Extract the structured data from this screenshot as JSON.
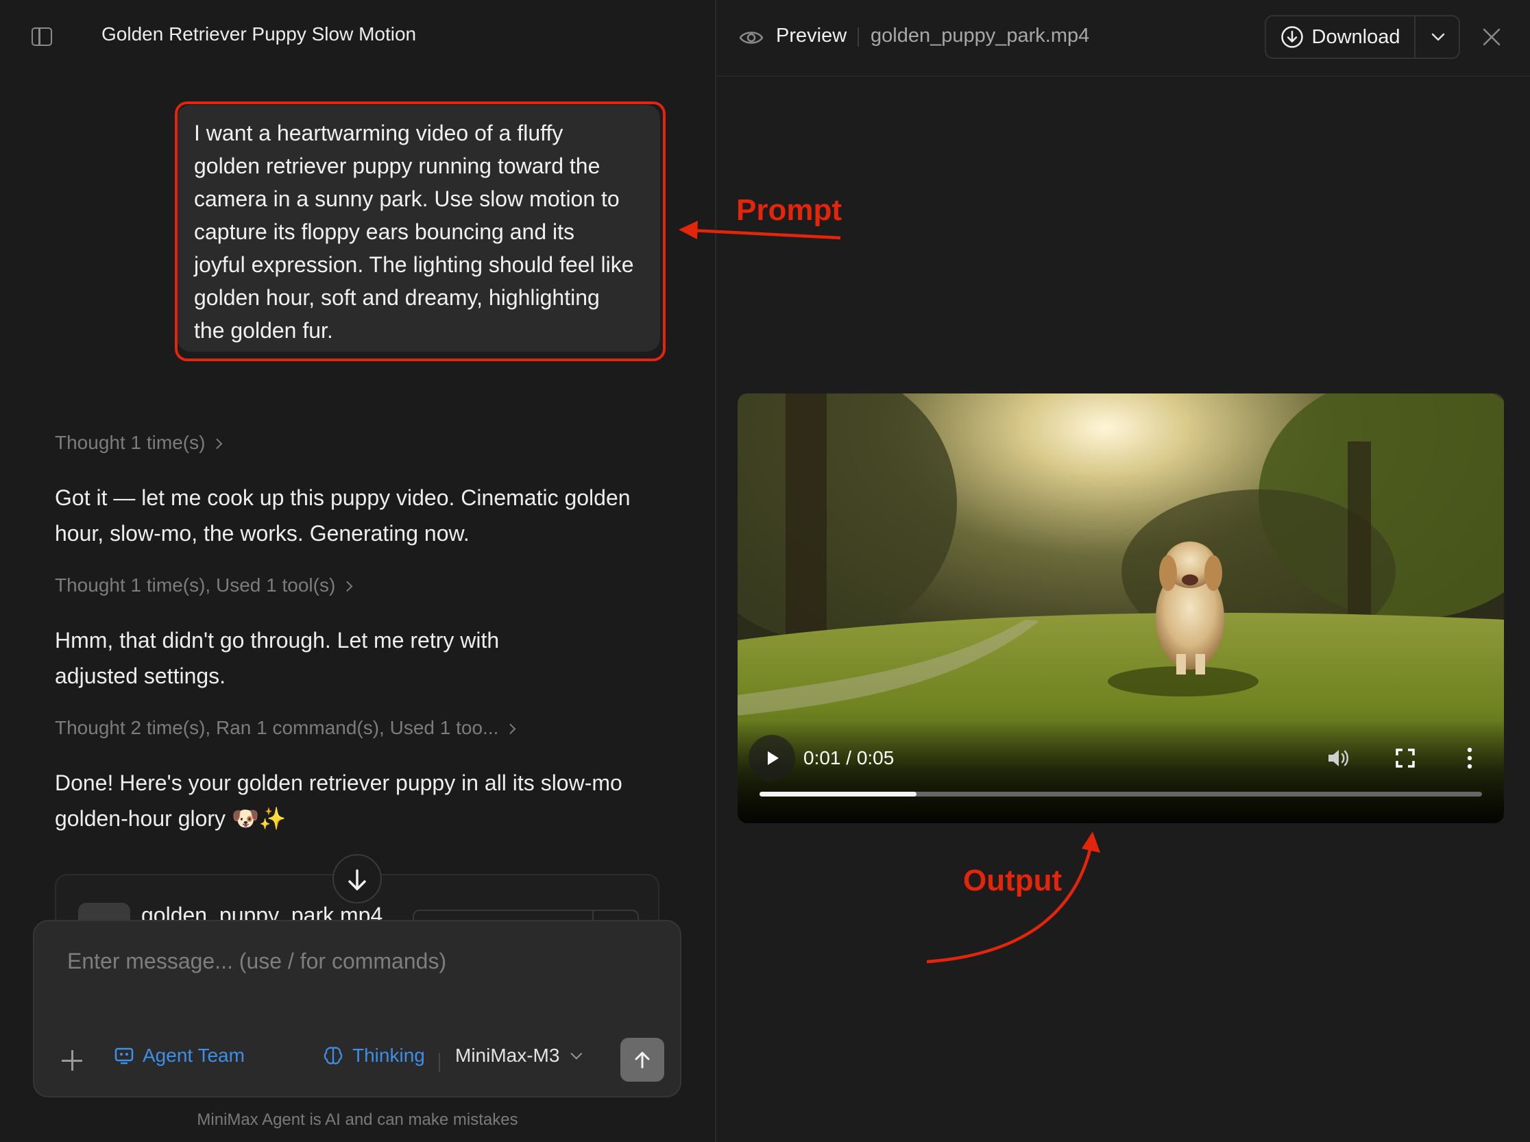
{
  "chat": {
    "title": "Golden Retriever Puppy Slow Motion",
    "prompt_lines": [
      "I want a heartwarming video of a fluffy",
      "golden retriever puppy running toward the",
      "camera in a sunny park. Use slow motion to",
      "capture its floppy ears bouncing and its",
      "joyful expression. The lighting should feel like",
      "golden hour, soft and dreamy, highlighting",
      "the golden fur."
    ],
    "thought_1": "Thought 1 time(s)",
    "msg_1_lines": [
      "Got it — let me cook up this puppy video. Cinematic golden",
      "hour, slow-mo, the works. Generating now."
    ],
    "thought_2": "Thought 1 time(s), Used 1 tool(s)",
    "msg_2_lines": [
      "Hmm, that didn't go through. Let me retry with",
      "adjusted settings."
    ],
    "thought_3": "Thought 2 time(s), Ran 1 command(s), Used 1 too...",
    "msg_3_lines": [
      "Done! Here's your golden retriever puppy in all its slow-mo",
      "golden-hour glory 🐶✨"
    ],
    "file_card_name": "golden_puppy_park.mp4"
  },
  "composer": {
    "placeholder": "Enter message... (use / for commands)",
    "agent_team_label": "Agent Team",
    "thinking_label": "Thinking",
    "model": "MiniMax-M3",
    "disclaimer": "MiniMax Agent is AI and can make mistakes"
  },
  "preview": {
    "label": "Preview",
    "file_name": "golden_puppy_park.mp4",
    "download_label": "Download",
    "video": {
      "time": "0:01 / 0:05",
      "progress": 0.217
    }
  },
  "annotations": {
    "prompt": "Prompt",
    "output": "Output",
    "color": "#e3250c"
  },
  "colors": {
    "accent": "#3d8fe8",
    "background": "#1b1b1b"
  }
}
